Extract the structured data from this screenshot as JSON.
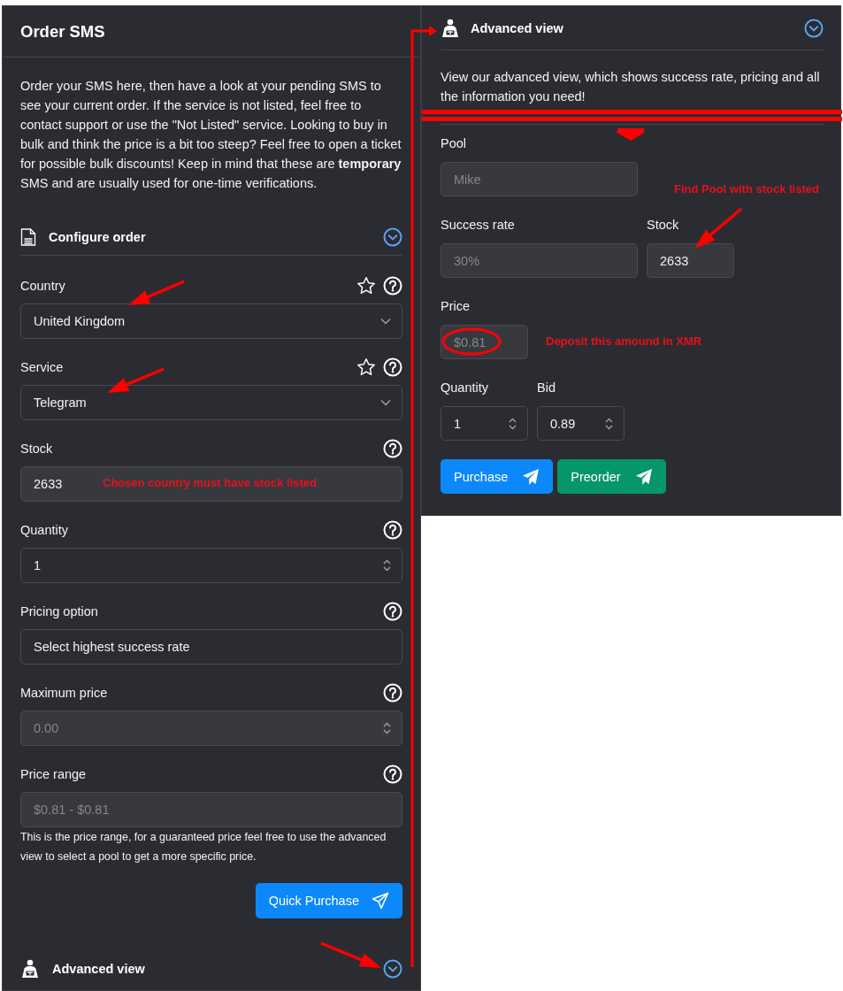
{
  "order_panel": {
    "title": "Order SMS",
    "description": "Order your SMS here, then have a look at your pending SMS to see your current order. If the service is not listed, feel free to contact support or use the \"Not Listed\" service. Looking to buy in bulk and think the price is a bit too steep? Feel free to open a ticket for possible bulk discounts! Keep in mind that these are **temporary** SMS and are usually used for one-time verifications.",
    "section_title": "Configure order",
    "fields": [
      {
        "kind": "select",
        "label": "Country",
        "value": "United Kingdom",
        "favorite": false,
        "disabled": false
      },
      {
        "kind": "select",
        "label": "Service",
        "value": "Telegram",
        "favorite": false,
        "disabled": false
      },
      {
        "kind": "readonly",
        "label": "Stock",
        "value": "2633",
        "disabled": false
      },
      {
        "kind": "number",
        "label": "Quantity",
        "value": "1",
        "disabled": false
      },
      {
        "kind": "text",
        "label": "Pricing option",
        "value": "Select highest success rate",
        "disabled": false
      },
      {
        "kind": "number",
        "label": "Maximum price",
        "value": "0.00",
        "disabled": true
      },
      {
        "kind": "text",
        "label": "Price range",
        "value": "$0.81 - $0.81",
        "disabled": true
      }
    ],
    "price_note": "This is the price range, for a guaranteed price feel free to use the advanced view to select a pool to get a more specific price.",
    "button": "Quick Purchase",
    "advanced_title": "Advanced view"
  },
  "advanced_panel": {
    "title": "Advanced view",
    "description": "View our advanced view, which shows success rate, pricing and all the information you need!",
    "rows": [
      [
        {
          "kind": "text",
          "label": "Pool",
          "value": "Mike",
          "disabled": true
        }
      ],
      [
        {
          "kind": "text",
          "label": "Success rate",
          "value": "30%",
          "disabled": true
        },
        {
          "kind": "readonly",
          "label": "Stock",
          "value": "2633",
          "disabled": false
        }
      ],
      [
        {
          "kind": "text",
          "label": "Price",
          "value": "$0.81",
          "disabled": true
        }
      ],
      [
        {
          "kind": "number",
          "label": "Quantity",
          "value": "1",
          "disabled": false
        },
        {
          "kind": "number",
          "label": "Bid",
          "value": "0.89",
          "disabled": false
        }
      ]
    ],
    "buttons": [
      {
        "label": "Purchase",
        "kind": "primary"
      },
      {
        "label": "Preorder",
        "kind": "success"
      }
    ]
  },
  "annotations": [
    {
      "text": "Chosen country must have stock listed"
    },
    {
      "text": "Find Pool with stock listed"
    },
    {
      "text": "Deposit this amound in XMR"
    }
  ]
}
